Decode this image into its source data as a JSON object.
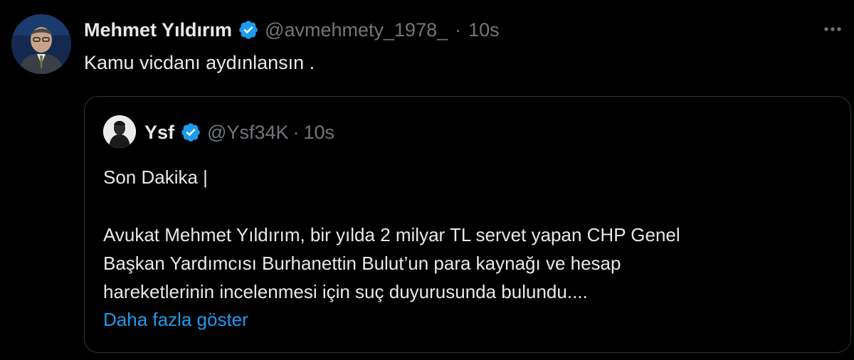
{
  "tweet": {
    "author_name": "Mehmet Yıldırım",
    "handle": "@avmehmety_1978_",
    "separator": "·",
    "time": "10s",
    "text": "Kamu vicdanı aydınlansın .",
    "more_icon": "more-options-icon",
    "verified_icon": "verified-badge-icon"
  },
  "quote": {
    "author_name": "Ysf",
    "handle": "@Ysf34K",
    "separator": "·",
    "time": "10s",
    "line1": "Son Dakika |",
    "para": [
      "Avukat Mehmet Yıldırım, bir yılda 2 milyar TL servet yapan CHP Genel",
      "Başkan Yardımcısı Burhanettin Bulut’un para kaynağı ve hesap",
      "hareketlerinin incelenmesi için suç duyurusunda bulundu...."
    ],
    "show_more": "Daha fazla göster"
  },
  "colors": {
    "background": "#000000",
    "text": "#e7e9ea",
    "muted": "#71767b",
    "link": "#1d9bf0",
    "border": "#2f3336",
    "verified": "#1d9bf0"
  }
}
